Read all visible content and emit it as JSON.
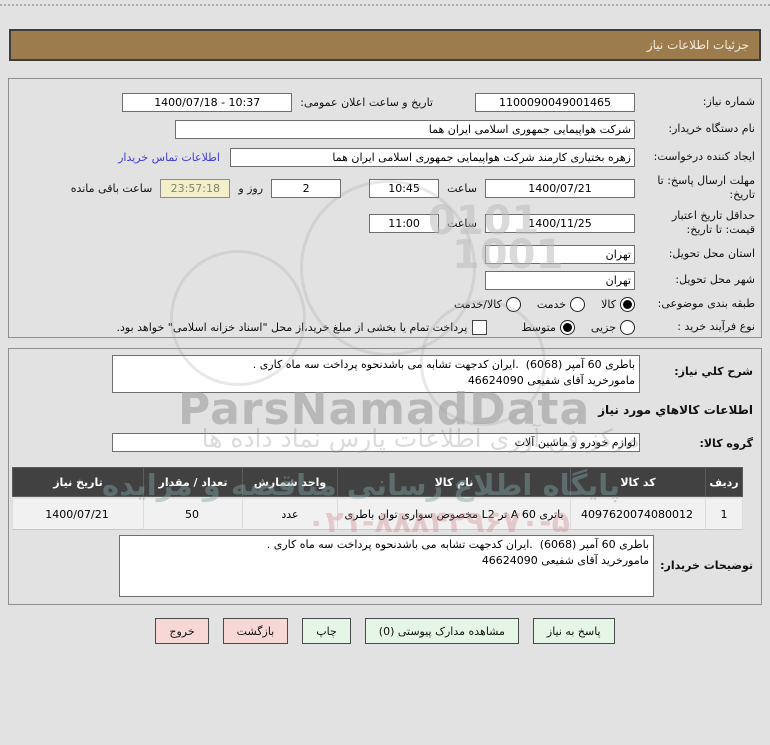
{
  "header": {
    "title": "جزئیات اطلاعات نیاز"
  },
  "colors": {
    "page_bg": "#e2e2e2",
    "titlebar_bg": "#9c7b4d",
    "table_header_bg": "#414141",
    "timer_bg": "#f3efcb",
    "link": "#4040d5",
    "button_green": "#e6f6e6",
    "button_pink": "#f8d7d7"
  },
  "need": {
    "number_label": "شماره نیاز:",
    "number": "1100090049001465",
    "announce_label": "تاریخ و ساعت اعلان عمومی:",
    "announce_value": "1400/07/18 - 10:37",
    "org_label": "نام دستگاه خریدار:",
    "org": "شرکت هواپیمایی جمهوری اسلامی ایران هما",
    "creator_label": "ایجاد کننده درخواست:",
    "creator": "زهره بختیاری کارمند شرکت هواپیمایی جمهوری اسلامی ایران هما",
    "contact_link": "اطلاعات تماس خریدار",
    "deadline_label": "مهلت ارسال پاسخ: تا تاریخ:",
    "deadline_date": "1400/07/21",
    "hour_label": "ساعت",
    "deadline_time": "10:45",
    "days_value": "2",
    "days_suffix": "روز و",
    "countdown": "23:57:18",
    "countdown_suffix": "ساعت باقی مانده",
    "validity_label": "حداقل تاریخ اعتبار قیمت: تا تاریخ:",
    "validity_date": "1400/11/25",
    "validity_time": "11:00",
    "province_label": "استان محل تحویل:",
    "province": "تهران",
    "city_label": "شهر محل تحویل:",
    "city": "تهران",
    "classification_label": "طبقه بندی موضوعی:",
    "classification": [
      {
        "label": "کالا",
        "selected": true
      },
      {
        "label": "خدمت",
        "selected": false
      },
      {
        "label": "کالا/خدمت",
        "selected": false
      }
    ],
    "process_label": "نوع فرآیند خرید :",
    "process": [
      {
        "label": "جزیی",
        "selected": false
      },
      {
        "label": "متوسط",
        "selected": true
      }
    ],
    "treasury_label": "پرداخت تمام یا بخشی از مبلغ خرید،از محل \"اسناد خزانه اسلامی\" خواهد بود.",
    "treasury_checked": false
  },
  "goods": {
    "description_label": "شرح کلي نیاز:",
    "description": "باطری 60 آمپر (6068)  .ایران کدجهت تشابه می باشدنحوه پرداخت سه ماه کاری .\nمامورخرید آقای شفیعی 46624090",
    "section_title": "اطلاعات کالاهاي مورد نیاز",
    "group_label": "گروه کالا:",
    "group_value": "لوازم خودرو و ماشین آلات",
    "table": {
      "headers": [
        "ردیف",
        "کد کالا",
        "نام کالا",
        "واحد شمارش",
        "تعداد / مقدار",
        "تاریخ نیاز"
      ],
      "rows": [
        {
          "row": "1",
          "code": "4097620074080012",
          "name": "باتری 60 A تر L2 مخصوص سواری توان باطری",
          "unit": "عدد",
          "qty": "50",
          "date": "1400/07/21"
        }
      ]
    },
    "notes_label": "توضیحات خریدار:",
    "notes": "باطری 60 آمپر (6068)  .ایران کدجهت تشابه می باشدنحوه پرداخت سه ماه کاری .\nمامورخرید آقای شفیعی 46624090"
  },
  "buttons": [
    {
      "label": "پاسخ به نیاز",
      "style": "green"
    },
    {
      "label": "مشاهده مدارک پیوستی (0)",
      "style": "green"
    },
    {
      "label": "چاپ",
      "style": "green"
    },
    {
      "label": "بازگشت",
      "style": "pink"
    },
    {
      "label": "خروج",
      "style": "pink"
    }
  ],
  "watermarks": {
    "brand": "ParsNamadData",
    "line1": "مرکز فن آوری اطلاعات پارس نماد داده ها",
    "line2": "پایگاه اطلاع رسانی مناقصه و مزایده",
    "phone": "۰۲۱-۸۸۸۴۲۹۶۷۰-۵",
    "num1": "0101",
    "num2": "1001"
  }
}
